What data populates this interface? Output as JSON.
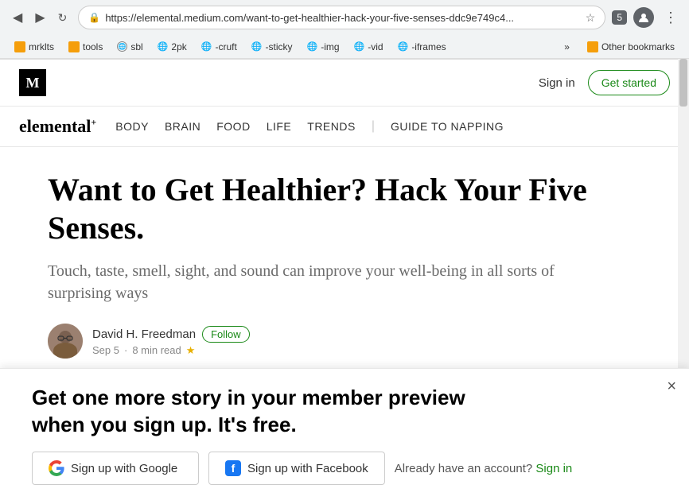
{
  "browser": {
    "back_icon": "◀",
    "forward_icon": "▶",
    "reload_icon": "↻",
    "address": "https://elemental.medium.com/want-to-get-healthier-hack-your-five-senses-ddc9e749c4...",
    "star_icon": "☆",
    "extension_label": "5",
    "profile_icon": "👤",
    "more_icon": "⋮"
  },
  "bookmarks": {
    "items": [
      {
        "label": "mrklts",
        "type": "yellow"
      },
      {
        "label": "tools",
        "type": "yellow"
      },
      {
        "label": "sbl",
        "type": "globe"
      },
      {
        "label": "2pk",
        "type": "globe"
      },
      {
        "label": "-cruft",
        "type": "globe"
      },
      {
        "label": "-sticky",
        "type": "globe"
      },
      {
        "label": "-img",
        "type": "globe"
      },
      {
        "label": "-vid",
        "type": "globe"
      },
      {
        "label": "-iframes",
        "type": "globe"
      }
    ],
    "more_label": "»",
    "other_label": "Other bookmarks"
  },
  "medium_header": {
    "logo": "M",
    "signin_label": "Sign in",
    "get_started_label": "Get started"
  },
  "pub_nav": {
    "logo": "elemental",
    "logo_sup": "+",
    "items": [
      "BODY",
      "BRAIN",
      "FOOD",
      "LIFE",
      "TRENDS"
    ],
    "guide_label": "GUIDE TO NAPPING"
  },
  "article": {
    "title": "Want to Get Healthier? Hack Your Five Senses.",
    "subtitle": "Touch, taste, smell, sight, and sound can improve your well-being in all sorts of surprising ways",
    "author_name": "David H. Freedman",
    "follow_label": "Follow",
    "date": "Sep 5",
    "read_time": "8 min read",
    "star": "★"
  },
  "banner": {
    "title": "Get one more story in your member preview when you sign up. It's free.",
    "close_icon": "×",
    "google_btn_label": "Sign up with Google",
    "facebook_btn_label": "Sign up with Facebook",
    "already_label": "Already have an account?",
    "signin_label": "Sign in"
  }
}
